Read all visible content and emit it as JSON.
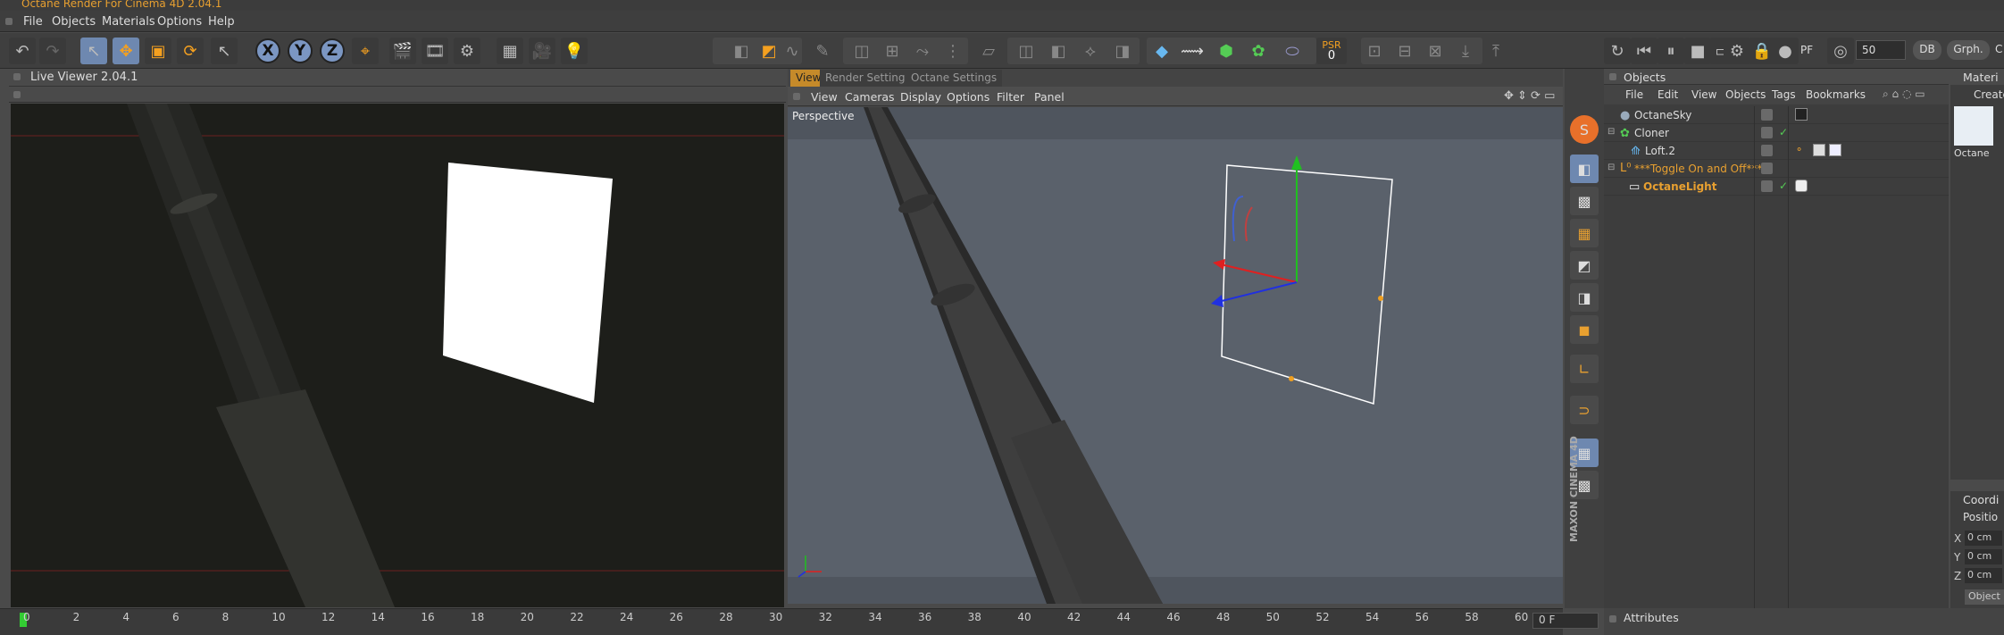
{
  "app": {
    "title": "Octane Render For Cinema 4D 2.04.1"
  },
  "menubar": {
    "items": [
      "File",
      "Objects",
      "Materials",
      "Options",
      "Help"
    ]
  },
  "toolbar": {
    "axis_x": "X",
    "axis_y": "Y",
    "axis_z": "Z",
    "psr_label": "PSR",
    "psr_value": "0",
    "zoom_value": "50",
    "db_button": "DB",
    "grph_button": "Grph.",
    "more": "C",
    "pf_label": "PF"
  },
  "live_viewer": {
    "title": "Live Viewer 2.04.1"
  },
  "viewport": {
    "tabs": [
      "View",
      "Render Settings",
      "Octane Settings"
    ],
    "active_tab": "View",
    "menu": [
      "View",
      "Cameras",
      "Display",
      "Options",
      "Filter",
      "Panel"
    ],
    "label": "Perspective"
  },
  "side_brand": "MAXON CINEMA 4D",
  "objects_panel": {
    "title": "Objects",
    "menu": [
      "File",
      "Edit",
      "View",
      "Objects",
      "Tags",
      "Bookmarks"
    ],
    "rows": [
      {
        "name": "OctaneSky",
        "highlight": false
      },
      {
        "name": "Cloner",
        "highlight": false
      },
      {
        "name": "Loft.2",
        "highlight": false
      },
      {
        "name": "***Toggle On and Off***",
        "highlight": true
      },
      {
        "name": "OctaneLight",
        "highlight": true
      }
    ]
  },
  "materials_panel": {
    "title": "Materi",
    "create": "Create",
    "material_name": "Octane"
  },
  "coordinates_panel": {
    "title": "Coordi",
    "position": "Positio",
    "rows": [
      {
        "axis": "X",
        "value": "0 cm"
      },
      {
        "axis": "Y",
        "value": "0 cm"
      },
      {
        "axis": "Z",
        "value": "0 cm"
      }
    ],
    "object_button": "Object"
  },
  "timeline": {
    "ticks": [
      "0",
      "2",
      "4",
      "6",
      "8",
      "10",
      "12",
      "14",
      "16",
      "18",
      "20",
      "22",
      "24",
      "26",
      "28",
      "30",
      "32",
      "34",
      "36",
      "38",
      "40",
      "42",
      "44",
      "46",
      "48",
      "50",
      "52",
      "54",
      "56",
      "58",
      "60"
    ],
    "current_frame": "0 F"
  },
  "attributes_panel": {
    "title": "Attributes"
  },
  "colors": {
    "accent_orange": "#e8a030",
    "axis_blue": "#7b96c2",
    "active_tab": "#c58a2a"
  }
}
